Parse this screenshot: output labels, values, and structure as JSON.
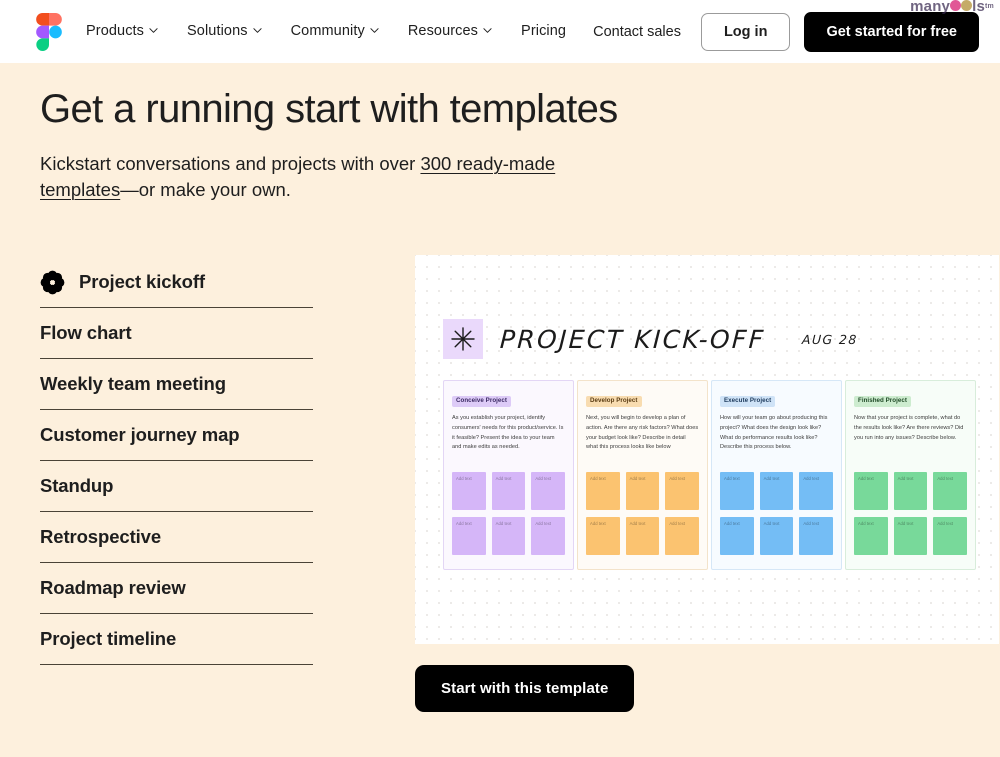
{
  "header": {
    "logo_icon": "figma-logo-icon",
    "nav": [
      {
        "label": "Products",
        "has_dropdown": true
      },
      {
        "label": "Solutions",
        "has_dropdown": true
      },
      {
        "label": "Community",
        "has_dropdown": true
      },
      {
        "label": "Resources",
        "has_dropdown": true
      },
      {
        "label": "Pricing",
        "has_dropdown": false
      }
    ],
    "contact_sales": "Contact sales",
    "login": "Log in",
    "get_started": "Get started for free",
    "watermark": "manytools",
    "watermark_sup": "tm"
  },
  "hero": {
    "title": "Get a running start with templates",
    "sub_before": "Kickstart conversations and projects with over ",
    "sub_link": "300 ready-made templates",
    "sub_after": "—or make your own."
  },
  "templates": {
    "items": [
      {
        "label": "Project kickoff",
        "icon": "flower-rosette-icon",
        "selected": true
      },
      {
        "label": "Flow chart",
        "icon": "",
        "selected": false
      },
      {
        "label": "Weekly team meeting",
        "icon": "",
        "selected": false
      },
      {
        "label": "Customer journey map",
        "icon": "",
        "selected": false
      },
      {
        "label": "Standup",
        "icon": "",
        "selected": false
      },
      {
        "label": "Retrospective",
        "icon": "",
        "selected": false
      },
      {
        "label": "Roadmap review",
        "icon": "",
        "selected": false
      },
      {
        "label": "Project timeline",
        "icon": "",
        "selected": false
      }
    ]
  },
  "board": {
    "star_icon": "asterisk-star-icon",
    "title": "PROJECT KICK-OFF",
    "date": "AUG 28",
    "note_placeholder": "Add text",
    "columns": [
      {
        "tag": "Conceive Project",
        "desc": "As you establish your project, identify consumers' needs for this product/service. Is it feasible? Present the idea to your team and make edits as needed.",
        "tag_bg": "#ddcbf7",
        "tag_color": "#3b2a63",
        "note_color": "#d5b6f8",
        "panel_bg": "#fbf8fe",
        "panel_border": "#e3d6f5"
      },
      {
        "tag": "Develop Project",
        "desc": "Next, you will begin to develop a plan of action. Are there any risk factors? What does your budget look like? Describe in detail what this process looks like below",
        "tag_bg": "#f8dcb0",
        "tag_color": "#5a3c13",
        "note_color": "#fbc370",
        "panel_bg": "#fefbf6",
        "panel_border": "#f3e3ca"
      },
      {
        "tag": "Execute Project",
        "desc": "How will your team go about producing this project? What does the design look like? What do performance results look like? Describe this process below.",
        "tag_bg": "#cfe3f7",
        "tag_color": "#1d3a5c",
        "note_color": "#74bdf5",
        "panel_bg": "#f7fbff",
        "panel_border": "#d6e7f7"
      },
      {
        "tag": "Finished Project",
        "desc": "Now that your project is complete, what do the results look like? Are there reviews? Did you run into any issues? Describe below.",
        "tag_bg": "#cdeccf",
        "tag_color": "#1f4a26",
        "note_color": "#78d99a",
        "panel_bg": "#f7fdf8",
        "panel_border": "#d8eddb"
      }
    ]
  },
  "cta": {
    "label": "Start with this template"
  },
  "colors": {
    "page_bg": "#fdf0dd",
    "header_bg": "#ffffff",
    "text": "#1e1e1e",
    "rule": "#4a4336",
    "board_bg": "#ffffff",
    "dark_button": "#000000"
  }
}
